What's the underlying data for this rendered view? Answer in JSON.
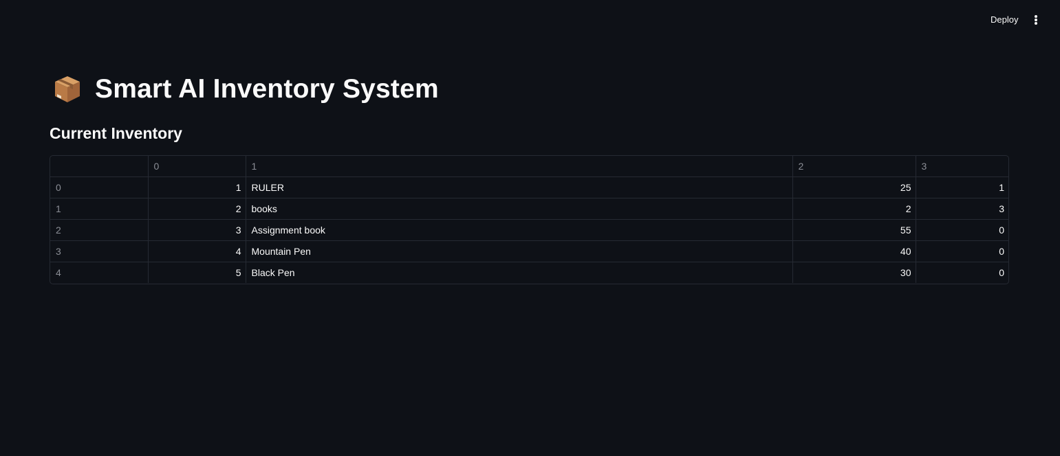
{
  "header": {
    "deploy_label": "Deploy",
    "menu_icon": "more-vertical-icon"
  },
  "page": {
    "title": "Smart AI Inventory System",
    "title_icon": "package-icon",
    "section_title": "Current Inventory"
  },
  "table": {
    "columns": [
      "",
      "0",
      "1",
      "2",
      "3"
    ],
    "rows": [
      {
        "index": "0",
        "c0": "1",
        "c1": "RULER",
        "c2": "25",
        "c3": "1"
      },
      {
        "index": "1",
        "c0": "2",
        "c1": "books",
        "c2": "2",
        "c3": "3"
      },
      {
        "index": "2",
        "c0": "3",
        "c1": "Assignment book",
        "c2": "55",
        "c3": "0"
      },
      {
        "index": "3",
        "c0": "4",
        "c1": "Mountain Pen",
        "c2": "40",
        "c3": "0"
      },
      {
        "index": "4",
        "c0": "5",
        "c1": "Black Pen",
        "c2": "30",
        "c3": "0"
      }
    ]
  },
  "colors": {
    "background": "#0e1117",
    "text": "#fafafa",
    "muted": "#8b8e96",
    "border": "#262a33"
  }
}
